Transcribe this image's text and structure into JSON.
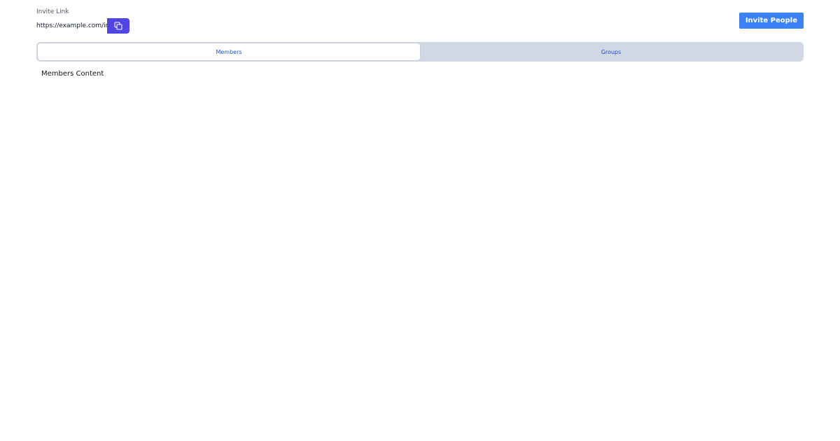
{
  "invite": {
    "label": "Invite Link",
    "link_value": "https://example.com/invite",
    "copy_icon": "copy-icon"
  },
  "header": {
    "invite_button_label": "Invite People"
  },
  "tabs": [
    {
      "label": "Members",
      "active": true
    },
    {
      "label": "Groups",
      "active": false
    }
  ],
  "content": {
    "text": "Members Content"
  },
  "colors": {
    "copy_button": "#4f46e5",
    "invite_button": "#3b82f6",
    "tab_text": "#1d4ed8",
    "tab_track": "#d1d7e5"
  }
}
